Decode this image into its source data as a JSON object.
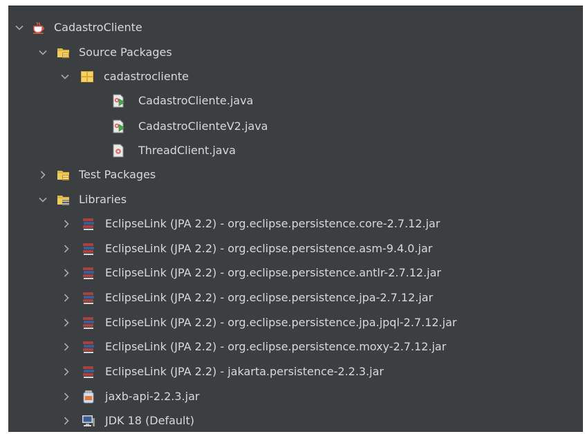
{
  "tree": {
    "project": {
      "label": "CadastroCliente",
      "icon": "coffee-cup-icon",
      "expanded": true
    },
    "source_packages": {
      "label": "Source Packages",
      "icon": "source-folder-icon",
      "expanded": true
    },
    "package": {
      "label": "cadastrocliente",
      "icon": "package-icon",
      "expanded": true
    },
    "files": [
      {
        "label": "CadastroCliente.java",
        "icon": "java-main-class-icon"
      },
      {
        "label": "CadastroClienteV2.java",
        "icon": "java-main-class-icon"
      },
      {
        "label": "ThreadClient.java",
        "icon": "java-class-icon"
      }
    ],
    "test_packages": {
      "label": "Test Packages",
      "icon": "test-folder-icon",
      "expanded": false
    },
    "libraries": {
      "label": "Libraries",
      "icon": "libraries-folder-icon",
      "expanded": true
    },
    "libs": [
      {
        "label": "EclipseLink (JPA 2.2) - org.eclipse.persistence.core-2.7.12.jar",
        "icon": "library-books-icon"
      },
      {
        "label": "EclipseLink (JPA 2.2) - org.eclipse.persistence.asm-9.4.0.jar",
        "icon": "library-books-icon"
      },
      {
        "label": "EclipseLink (JPA 2.2) - org.eclipse.persistence.antlr-2.7.12.jar",
        "icon": "library-books-icon"
      },
      {
        "label": "EclipseLink (JPA 2.2) - org.eclipse.persistence.jpa-2.7.12.jar",
        "icon": "library-books-icon"
      },
      {
        "label": "EclipseLink (JPA 2.2) - org.eclipse.persistence.jpa.jpql-2.7.12.jar",
        "icon": "library-books-icon"
      },
      {
        "label": "EclipseLink (JPA 2.2) - org.eclipse.persistence.moxy-2.7.12.jar",
        "icon": "library-books-icon"
      },
      {
        "label": "EclipseLink (JPA 2.2) - jakarta.persistence-2.2.3.jar",
        "icon": "library-books-icon"
      },
      {
        "label": "jaxb-api-2.2.3.jar",
        "icon": "jar-file-icon"
      },
      {
        "label": "JDK 18 (Default)",
        "icon": "jdk-monitor-icon"
      }
    ]
  },
  "colors": {
    "background": "#3c3f41",
    "text": "#d8d8d8",
    "chevron": "#a9a9a9",
    "folder": "#e0b84a",
    "library_red": "#a9413c",
    "library_blue": "#3b5e99"
  }
}
